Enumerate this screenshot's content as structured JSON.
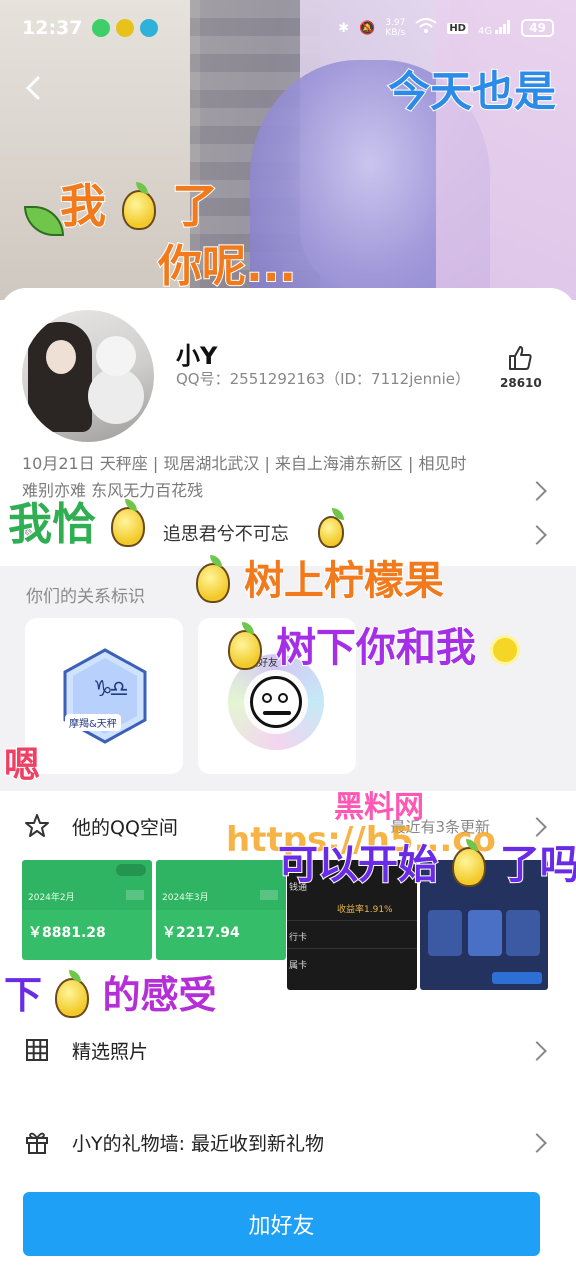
{
  "status_bar": {
    "time": "12:37",
    "net_speed": "3.97\nKB/s",
    "hd": "HD",
    "net_type": "4G",
    "battery": "49"
  },
  "profile": {
    "name": "小Y",
    "qq_label": "QQ号：",
    "qq_number": "2551292163",
    "id_text": "（ID：7112jennie）",
    "likes": "28610",
    "info_line1": "10月21日  天秤座  |  现居湖北武汉  |  来自上海浦东新区  |  相见时",
    "info_line2": "难别亦难  东风无力百花残",
    "signature": "追思君兮不可忘"
  },
  "relationship": {
    "title": "你们的关系标识",
    "badge1_label": "摩羯&天秤",
    "badge2_label": "宝藏好友"
  },
  "qzone": {
    "label": "他的QQ空间",
    "update_text": "最近有3条更新",
    "thumb1_date": "2024年2月",
    "thumb1_amount": "￥8881.28",
    "thumb2_date": "2024年3月",
    "thumb2_amount": "￥2217.94",
    "thumb3_lines": [
      "钱通",
      "收益率1.91%",
      "行卡",
      "属卡"
    ]
  },
  "rows": {
    "photos": "精选照片",
    "gifts": "小Y的礼物墙: 最近收到新礼物"
  },
  "add_button": "加好友",
  "overlays": {
    "top_right": "今天也是",
    "cover_left1": "我",
    "cover_left2": "了",
    "cover_left3": "你呢...",
    "left_mid": "我恰",
    "tree1": "树上柠檬果",
    "tree2": "树下你和我",
    "watermark1": "黑料网",
    "watermark2": "https://h5...co",
    "start": "可以开始",
    "start2": "了吗",
    "feel": "下",
    "feel2": "的感受",
    "ah": "嗯"
  },
  "colors": {
    "accent": "#1ea0f7",
    "sticker_orange": "#f07a1c",
    "sticker_purple": "#6a2be6",
    "sticker_green": "#2fae52"
  }
}
